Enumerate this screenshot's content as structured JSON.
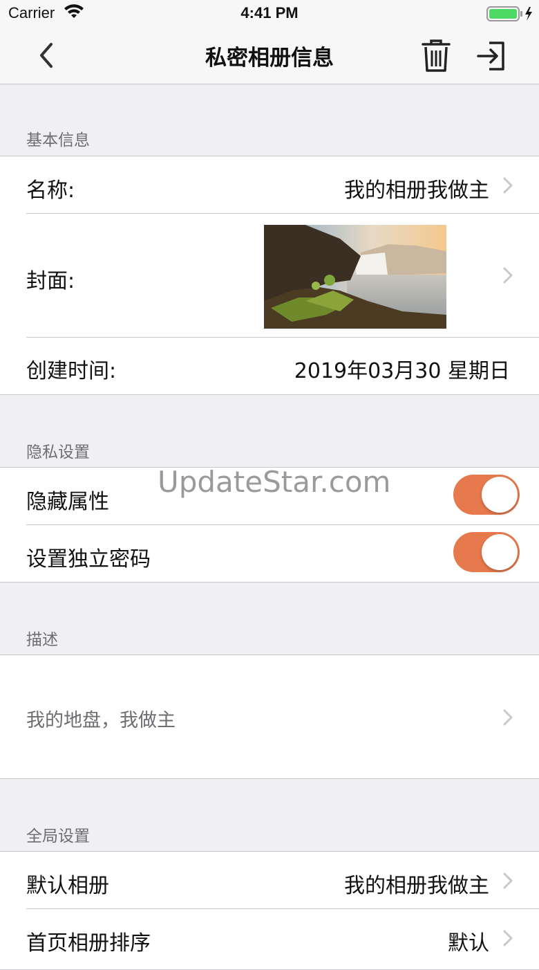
{
  "status": {
    "carrier": "Carrier",
    "time": "4:41 PM"
  },
  "nav": {
    "title": "私密相册信息",
    "icons": [
      "chevron-left-icon",
      "trash-icon",
      "export-icon"
    ]
  },
  "sections": {
    "basic": {
      "header": "基本信息",
      "name_label": "名称:",
      "name_value": "我的相册我做主",
      "cover_label": "封面:",
      "created_label": "创建时间:",
      "created_value": "2019年03月30 星期日"
    },
    "privacy": {
      "header": "隐私设置",
      "hidden_label": "隐藏属性",
      "hidden_on": true,
      "password_label": "设置独立密码",
      "password_on": true
    },
    "description": {
      "header": "描述",
      "text": "我的地盘，我做主"
    },
    "global": {
      "header": "全局设置",
      "default_album_label": "默认相册",
      "default_album_value": "我的相册我做主",
      "sort_label": "首页相册排序",
      "sort_value": "默认"
    }
  },
  "watermark": "UpdateStar.com",
  "colors": {
    "toggle_on": "#e67a4d",
    "background": "#efeff4"
  }
}
